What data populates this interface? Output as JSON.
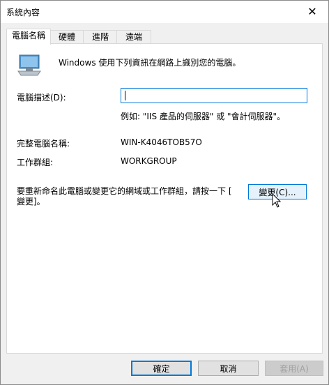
{
  "window": {
    "title": "系統內容",
    "close_glyph": "✕"
  },
  "tabs": [
    {
      "label": "電腦名稱",
      "active": true
    },
    {
      "label": "硬體",
      "active": false
    },
    {
      "label": "進階",
      "active": false
    },
    {
      "label": "遠端",
      "active": false
    }
  ],
  "panel": {
    "intro_text": "Windows 使用下列資訊在網路上識別您的電腦。",
    "description_label": "電腦描述(D):",
    "description_value": "",
    "description_example": "例如: \"IIS 產品的伺服器\" 或 \"會計伺服器\"。",
    "full_name_label": "完整電腦名稱:",
    "full_name_value": "WIN-K4046TOB57O",
    "workgroup_label": "工作群組:",
    "workgroup_value": "WORKGROUP",
    "rename_text_line1": "要重新命名此電腦或變更它的網域或工作群組，請按一下 [",
    "rename_text_line2": "變更]。",
    "change_button": "變更(C)..."
  },
  "footer": {
    "ok_button": "確定",
    "cancel_button": "取消",
    "apply_button": "套用(A)"
  },
  "colors": {
    "accent": "#0078d7",
    "dialog_bg": "#f0f0f0",
    "button_bg": "#e1e1e1"
  },
  "icons": {
    "computer": "computer-icon",
    "close": "close-icon",
    "pointer": "mouse-pointer-icon"
  }
}
